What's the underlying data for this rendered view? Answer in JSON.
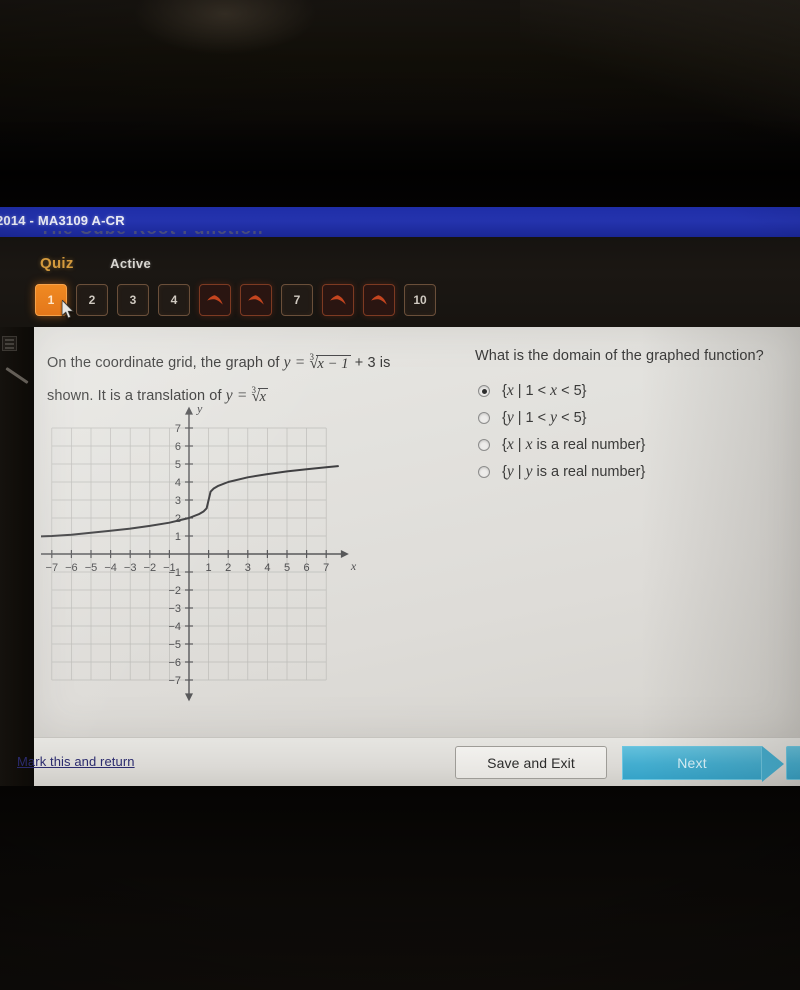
{
  "window": {
    "titlebar_text": "2014 - MA3109 A-CR",
    "page_heading_obscured": "The Cube Root Function"
  },
  "quiz_header": {
    "quiz_label": "Quiz",
    "status_label": "Active",
    "questions": [
      {
        "label": "1",
        "state": "current"
      },
      {
        "label": "2",
        "state": "number"
      },
      {
        "label": "3",
        "state": "number"
      },
      {
        "label": "4",
        "state": "number"
      },
      {
        "label": "",
        "state": "arrow"
      },
      {
        "label": "",
        "state": "arrow"
      },
      {
        "label": "7",
        "state": "number"
      },
      {
        "label": "",
        "state": "arrow"
      },
      {
        "label": "",
        "state": "arrow"
      },
      {
        "label": "10",
        "state": "number"
      }
    ]
  },
  "question": {
    "stem_part1": "On the coordinate grid, the graph of",
    "stem_expr_var": "y",
    "stem_eq": "=",
    "stem_radicand": "x − 1",
    "stem_plus": "+ 3 is",
    "stem_part2_pre": "shown. It is a translation of",
    "stem_part2_var": "y",
    "stem_part2_eq": "=",
    "stem_part2_radicand": "x",
    "root_index": "3",
    "prompt": "What is the domain of the graphed function?",
    "choices": [
      {
        "text": "{x | 1 < x < 5}",
        "selected": true
      },
      {
        "text": "{y | 1 < y < 5}",
        "selected": false
      },
      {
        "text": "{x | x is a real number}",
        "selected": false
      },
      {
        "text": "{y | y is a real number}",
        "selected": false
      }
    ]
  },
  "chart_data": {
    "type": "line",
    "title": "",
    "xlabel": "x",
    "ylabel": "y",
    "xlim": [
      -7.8,
      7.8
    ],
    "ylim": [
      -7.8,
      7.8
    ],
    "grid": true,
    "grid_extent": {
      "x": [
        -7,
        7
      ],
      "y": [
        -7,
        7
      ]
    },
    "xticks": [
      -7,
      -6,
      -5,
      -4,
      -3,
      -2,
      -1,
      1,
      2,
      3,
      4,
      5,
      6,
      7
    ],
    "yticks": [
      -7,
      -6,
      -5,
      -4,
      -3,
      -2,
      -1,
      1,
      2,
      3,
      4,
      5,
      6,
      7
    ],
    "xticklabels": [
      "−7",
      "−6",
      "−5",
      "−4",
      "−3",
      "−2",
      "−1",
      "1",
      "2",
      "3",
      "4",
      "5",
      "6",
      "7"
    ],
    "yticklabels": [
      "−7",
      "−6",
      "−5",
      "−4",
      "−3",
      "−2",
      "−1",
      "1",
      "2",
      "3",
      "4",
      "5",
      "6",
      "7"
    ],
    "series": [
      {
        "name": "y = cbrt(x - 1) + 3",
        "equation": "y = ∛(x − 1) + 3",
        "inflection_point": [
          1,
          3
        ],
        "color": "#3f3f41",
        "x": [
          -7.6,
          -7,
          -6,
          -5,
          -4,
          -3,
          -2,
          -1,
          0,
          0.5,
          0.75,
          0.9,
          1,
          1.1,
          1.25,
          1.5,
          2,
          3,
          4,
          5,
          6,
          7,
          7.6
        ],
        "y": [
          0.98,
          1.0,
          1.07,
          1.18,
          1.29,
          1.41,
          1.56,
          1.74,
          2.0,
          2.21,
          2.37,
          2.54,
          3.0,
          3.46,
          3.63,
          3.79,
          4.0,
          4.26,
          4.44,
          4.59,
          4.71,
          4.82,
          4.88
        ]
      }
    ]
  },
  "action_bar": {
    "mark_link": "Mark this and return",
    "save_exit_label": "Save and Exit",
    "next_label": "Next"
  }
}
